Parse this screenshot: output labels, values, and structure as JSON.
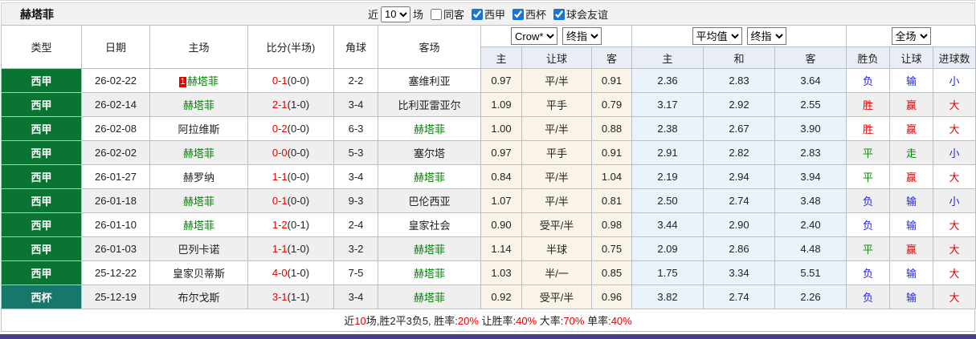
{
  "title": "赫塔菲",
  "toolbar": {
    "recent_label": "近",
    "matches_count": "10",
    "matches_unit": "场",
    "same_venue": {
      "label": "同客",
      "checked": false
    },
    "filters": [
      {
        "label": "西甲",
        "checked": true
      },
      {
        "label": "西杯",
        "checked": true
      },
      {
        "label": "球会友谊",
        "checked": true
      }
    ]
  },
  "header": {
    "left_columns": [
      "类型",
      "日期",
      "主场",
      "比分(半场)",
      "角球",
      "客场"
    ],
    "selects": {
      "odds_company": "Crow*",
      "odds_stage_hcp": "终指",
      "avg_mode": "平均值",
      "odds_stage_avg": "终指",
      "scope": "全场"
    },
    "sub_columns": [
      "主",
      "让球",
      "客",
      "主",
      "和",
      "客",
      "胜负",
      "让球",
      "进球数"
    ]
  },
  "rows": [
    {
      "league": "西甲",
      "league_key": "liga",
      "date": "26-02-22",
      "home": "赫塔菲",
      "home_self": true,
      "home_badge": "1",
      "score": "0-1",
      "half": "(0-0)",
      "corners": "2-2",
      "away": "塞维利亚",
      "hcp_home": "0.97",
      "hcp_line": "平/半",
      "hcp_away": "0.91",
      "avg_home": "2.36",
      "avg_draw": "2.83",
      "avg_away": "3.64",
      "result": "负",
      "result_key": "lose",
      "hcp_result": "输",
      "hcp_result_key": "lose",
      "goals": "小",
      "goals_key": "under"
    },
    {
      "league": "西甲",
      "league_key": "liga",
      "date": "26-02-14",
      "home": "赫塔菲",
      "home_self": true,
      "score": "2-1",
      "half": "(1-0)",
      "corners": "3-4",
      "away": "比利亚雷亚尔",
      "hcp_home": "1.09",
      "hcp_line": "平手",
      "hcp_away": "0.79",
      "avg_home": "3.17",
      "avg_draw": "2.92",
      "avg_away": "2.55",
      "result": "胜",
      "result_key": "win",
      "hcp_result": "赢",
      "hcp_result_key": "win",
      "goals": "大",
      "goals_key": "over"
    },
    {
      "league": "西甲",
      "league_key": "liga",
      "date": "26-02-08",
      "home": "阿拉维斯",
      "away_self": true,
      "score": "0-2",
      "half": "(0-0)",
      "corners": "6-3",
      "away": "赫塔菲",
      "hcp_home": "1.00",
      "hcp_line": "平/半",
      "hcp_away": "0.88",
      "avg_home": "2.38",
      "avg_draw": "2.67",
      "avg_away": "3.90",
      "result": "胜",
      "result_key": "win",
      "hcp_result": "赢",
      "hcp_result_key": "win",
      "goals": "大",
      "goals_key": "over"
    },
    {
      "league": "西甲",
      "league_key": "liga",
      "date": "26-02-02",
      "home": "赫塔菲",
      "home_self": true,
      "score": "0-0",
      "half": "(0-0)",
      "corners": "5-3",
      "away": "塞尔塔",
      "hcp_home": "0.97",
      "hcp_line": "平手",
      "hcp_away": "0.91",
      "avg_home": "2.91",
      "avg_draw": "2.82",
      "avg_away": "2.83",
      "result": "平",
      "result_key": "draw",
      "hcp_result": "走",
      "hcp_result_key": "draw",
      "goals": "小",
      "goals_key": "under"
    },
    {
      "league": "西甲",
      "league_key": "liga",
      "date": "26-01-27",
      "home": "赫罗纳",
      "away_self": true,
      "score": "1-1",
      "half": "(0-0)",
      "corners": "3-4",
      "away": "赫塔菲",
      "hcp_home": "0.84",
      "hcp_line": "平/半",
      "hcp_away": "1.04",
      "avg_home": "2.19",
      "avg_draw": "2.94",
      "avg_away": "3.94",
      "result": "平",
      "result_key": "draw",
      "hcp_result": "赢",
      "hcp_result_key": "win",
      "goals": "大",
      "goals_key": "over"
    },
    {
      "league": "西甲",
      "league_key": "liga",
      "date": "26-01-18",
      "home": "赫塔菲",
      "home_self": true,
      "score": "0-1",
      "half": "(0-0)",
      "corners": "9-3",
      "away": "巴伦西亚",
      "hcp_home": "1.07",
      "hcp_line": "平/半",
      "hcp_away": "0.81",
      "avg_home": "2.50",
      "avg_draw": "2.74",
      "avg_away": "3.48",
      "result": "负",
      "result_key": "lose",
      "hcp_result": "输",
      "hcp_result_key": "lose",
      "goals": "小",
      "goals_key": "under"
    },
    {
      "league": "西甲",
      "league_key": "liga",
      "date": "26-01-10",
      "home": "赫塔菲",
      "home_self": true,
      "score": "1-2",
      "half": "(0-1)",
      "corners": "2-4",
      "away": "皇家社会",
      "hcp_home": "0.90",
      "hcp_line": "受平/半",
      "hcp_away": "0.98",
      "avg_home": "3.44",
      "avg_draw": "2.90",
      "avg_away": "2.40",
      "result": "负",
      "result_key": "lose",
      "hcp_result": "输",
      "hcp_result_key": "lose",
      "goals": "大",
      "goals_key": "over"
    },
    {
      "league": "西甲",
      "league_key": "liga",
      "date": "26-01-03",
      "home": "巴列卡诺",
      "away_self": true,
      "score": "1-1",
      "half": "(1-0)",
      "corners": "3-2",
      "away": "赫塔菲",
      "hcp_home": "1.14",
      "hcp_line": "半球",
      "hcp_away": "0.75",
      "avg_home": "2.09",
      "avg_draw": "2.86",
      "avg_away": "4.48",
      "result": "平",
      "result_key": "draw",
      "hcp_result": "赢",
      "hcp_result_key": "win",
      "goals": "大",
      "goals_key": "over"
    },
    {
      "league": "西甲",
      "league_key": "liga",
      "date": "25-12-22",
      "home": "皇家贝蒂斯",
      "away_self": true,
      "score": "4-0",
      "half": "(1-0)",
      "corners": "7-5",
      "away": "赫塔菲",
      "hcp_home": "1.03",
      "hcp_line": "半/一",
      "hcp_away": "0.85",
      "avg_home": "1.75",
      "avg_draw": "3.34",
      "avg_away": "5.51",
      "result": "负",
      "result_key": "lose",
      "hcp_result": "输",
      "hcp_result_key": "lose",
      "goals": "大",
      "goals_key": "over"
    },
    {
      "league": "西杯",
      "league_key": "cup",
      "date": "25-12-19",
      "home": "布尔戈斯",
      "away_self": true,
      "score": "3-1",
      "half": "(1-1)",
      "corners": "3-4",
      "away": "赫塔菲",
      "hcp_home": "0.92",
      "hcp_line": "受平/半",
      "hcp_away": "0.96",
      "avg_home": "3.82",
      "avg_draw": "2.74",
      "avg_away": "2.26",
      "result": "负",
      "result_key": "lose",
      "hcp_result": "输",
      "hcp_result_key": "lose",
      "goals": "大",
      "goals_key": "over"
    }
  ],
  "footer": {
    "segments": [
      {
        "text": "近",
        "red": false
      },
      {
        "text": "10",
        "red": true
      },
      {
        "text": "场,胜2平3负5, 胜率:",
        "red": false
      },
      {
        "text": "20%",
        "red": true
      },
      {
        "text": " 让胜率:",
        "red": false
      },
      {
        "text": "40%",
        "red": true
      },
      {
        "text": " 大率:",
        "red": false
      },
      {
        "text": "70%",
        "red": true
      },
      {
        "text": " 单率:",
        "red": false
      },
      {
        "text": "40%",
        "red": true
      }
    ]
  }
}
